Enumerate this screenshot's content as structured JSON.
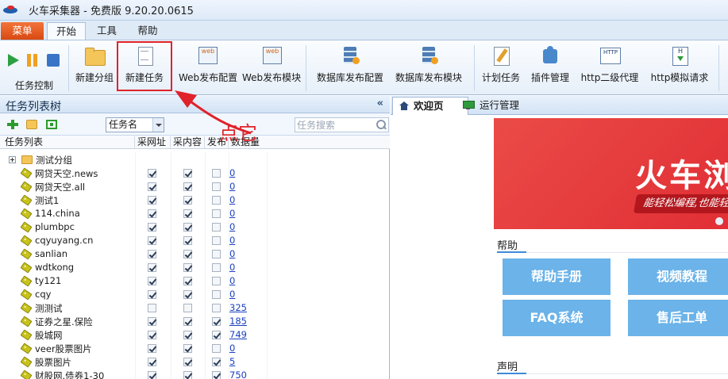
{
  "window": {
    "title": "火车采集器 - 免费版 9.20.20.0615"
  },
  "ribbon_tabs": {
    "menu": "菜单",
    "start": "开始",
    "tools": "工具",
    "help": "帮助"
  },
  "ribbon": {
    "task_control_label": "任务控制",
    "new_group": "新建分组",
    "new_task": "新建任务",
    "web_publish_config": "Web发布配置",
    "web_publish_module": "Web发布模块",
    "db_publish_config": "数据库发布配置",
    "db_publish_module": "数据库发布模块",
    "scheduled_task": "计划任务",
    "plugin_manage": "插件管理",
    "http_proxy": "http二级代理",
    "http_simulate": "http模拟请求"
  },
  "annotation": {
    "text": "点它",
    "color": "#e0222a"
  },
  "task_panel": {
    "title": "任务列表树",
    "collapse_glyph": "«",
    "field_select": "任务名",
    "search_placeholder": "任务搜索",
    "columns": {
      "name": "任务列表",
      "collect_url": "采网址",
      "collect_content": "采内容",
      "publish": "发布",
      "data_count": "数据量"
    },
    "group": {
      "name": "测试分组"
    },
    "tasks": [
      {
        "name": "网贷天空.news",
        "url": true,
        "content": true,
        "publish": false,
        "count": "0"
      },
      {
        "name": "网贷天空.all",
        "url": true,
        "content": true,
        "publish": false,
        "count": "0"
      },
      {
        "name": "测试1",
        "url": true,
        "content": true,
        "publish": false,
        "count": "0"
      },
      {
        "name": "114.china",
        "url": true,
        "content": true,
        "publish": false,
        "count": "0"
      },
      {
        "name": "plumbpc",
        "url": true,
        "content": true,
        "publish": false,
        "count": "0"
      },
      {
        "name": "cqyuyang.cn",
        "url": true,
        "content": true,
        "publish": false,
        "count": "0"
      },
      {
        "name": "sanlian",
        "url": true,
        "content": true,
        "publish": false,
        "count": "0"
      },
      {
        "name": "wdtkong",
        "url": true,
        "content": true,
        "publish": false,
        "count": "0"
      },
      {
        "name": "ty121",
        "url": true,
        "content": true,
        "publish": false,
        "count": "0"
      },
      {
        "name": "cqy",
        "url": true,
        "content": true,
        "publish": false,
        "count": "0"
      },
      {
        "name": "测测试",
        "url": false,
        "content": false,
        "publish": false,
        "count": "325"
      },
      {
        "name": "证券之星.保险",
        "url": true,
        "content": true,
        "publish": true,
        "count": "185"
      },
      {
        "name": "股城网",
        "url": true,
        "content": true,
        "publish": true,
        "count": "749"
      },
      {
        "name": "veer股票图片",
        "url": true,
        "content": true,
        "publish": false,
        "count": "0"
      },
      {
        "name": "股票图片",
        "url": true,
        "content": true,
        "publish": true,
        "count": "5"
      },
      {
        "name": "财股网.债券1-30",
        "url": true,
        "content": true,
        "publish": true,
        "count": "750"
      }
    ]
  },
  "right_panel": {
    "tabs": {
      "welcome": "欢迎页",
      "run_manage": "运行管理"
    },
    "banner": {
      "title": "火车浏",
      "subtitle": "能轻松编程,也能轻"
    },
    "help_heading": "帮助",
    "buttons": {
      "manual": "帮助手册",
      "video": "视频教程",
      "faq": "FAQ系统",
      "support": "售后工单"
    },
    "declaration_heading": "声明"
  }
}
